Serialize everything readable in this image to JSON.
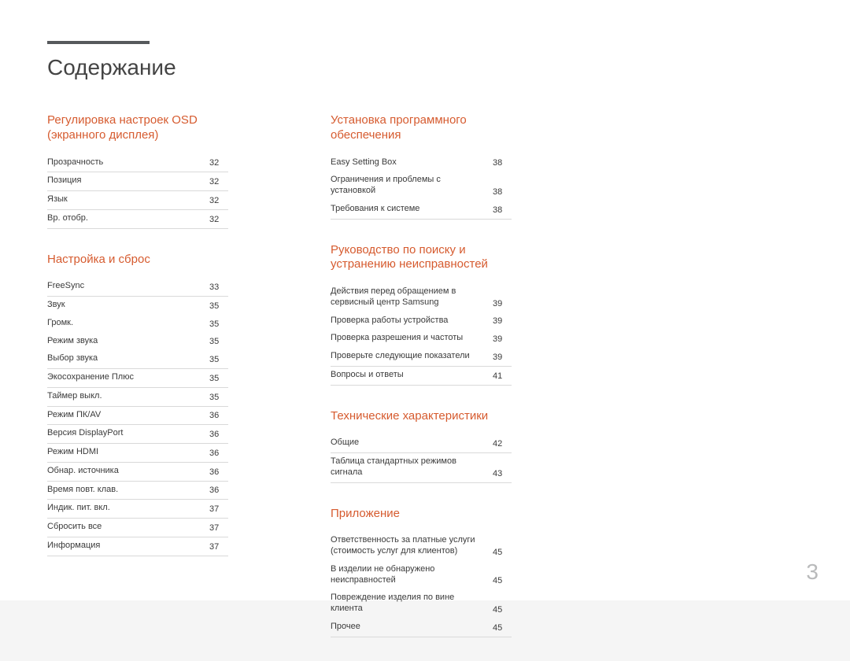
{
  "title": "Содержание",
  "pageNumber": "3",
  "left": [
    {
      "title": "Регулировка настроек OSD (экранного дисплея)",
      "entries": [
        {
          "label": "Прозрачность",
          "page": "32",
          "bordered": true
        },
        {
          "label": "Позиция",
          "page": "32",
          "bordered": true
        },
        {
          "label": "Язык",
          "page": "32",
          "bordered": true
        },
        {
          "label": "Вр. отобр.",
          "page": "32",
          "bordered": true
        }
      ]
    },
    {
      "title": "Настройка и сброс",
      "entries": [
        {
          "label": "FreeSync",
          "page": "33",
          "bordered": true
        },
        {
          "label": "Звук",
          "page": "35",
          "bordered": false
        },
        {
          "label": "Громк.",
          "page": "35",
          "bordered": false,
          "sub": true
        },
        {
          "label": "Режим звука",
          "page": "35",
          "bordered": false,
          "sub": true
        },
        {
          "label": "Выбор звука",
          "page": "35",
          "bordered": true,
          "sub": true
        },
        {
          "label": "Экосохранение Плюс",
          "page": "35",
          "bordered": true
        },
        {
          "label": "Таймер выкл.",
          "page": "35",
          "bordered": true
        },
        {
          "label": "Режим ПК/AV",
          "page": "36",
          "bordered": true
        },
        {
          "label": "Версия DisplayPort",
          "page": "36",
          "bordered": true
        },
        {
          "label": "Режим HDMI",
          "page": "36",
          "bordered": true
        },
        {
          "label": "Обнар. источника",
          "page": "36",
          "bordered": true
        },
        {
          "label": "Время повт. клав.",
          "page": "36",
          "bordered": true
        },
        {
          "label": "Индик. пит. вкл.",
          "page": "37",
          "bordered": true
        },
        {
          "label": "Сбросить все",
          "page": "37",
          "bordered": true
        },
        {
          "label": "Информация",
          "page": "37",
          "bordered": true
        }
      ]
    }
  ],
  "right": [
    {
      "title": "Установка программного обеспечения",
      "entries": [
        {
          "label": "Easy Setting Box",
          "page": "38",
          "bordered": false
        },
        {
          "label": "Ограничения и проблемы с установкой",
          "page": "38",
          "bordered": false,
          "sub": true
        },
        {
          "label": "Требования к системе",
          "page": "38",
          "bordered": true,
          "sub": true
        }
      ]
    },
    {
      "title": "Руководство по поиску и устранению неисправностей",
      "entries": [
        {
          "label": "Действия перед обращением в сервисный центр Samsung",
          "page": "39",
          "bordered": false
        },
        {
          "label": "Проверка работы устройства",
          "page": "39",
          "bordered": false,
          "sub": true
        },
        {
          "label": "Проверка разрешения и частоты",
          "page": "39",
          "bordered": false,
          "sub": true
        },
        {
          "label": "Проверьте следующие показатели",
          "page": "39",
          "bordered": true,
          "sub": true
        },
        {
          "label": "Вопросы и ответы",
          "page": "41",
          "bordered": true
        }
      ]
    },
    {
      "title": "Технические характеристики",
      "entries": [
        {
          "label": "Общие",
          "page": "42",
          "bordered": true
        },
        {
          "label": "Таблица стандартных режимов сигнала",
          "page": "43",
          "bordered": true
        }
      ]
    },
    {
      "title": "Приложение",
      "entries": [
        {
          "label": "Ответственность за платные услуги (стоимость услуг для клиентов)",
          "page": "45",
          "bordered": false
        },
        {
          "label": "В изделии не обнаружено неисправностей",
          "page": "45",
          "bordered": false,
          "sub": true
        },
        {
          "label": "Повреждение изделия по вине клиента",
          "page": "45",
          "bordered": false,
          "sub": true
        },
        {
          "label": "Прочее",
          "page": "45",
          "bordered": true,
          "sub": true
        }
      ]
    }
  ]
}
